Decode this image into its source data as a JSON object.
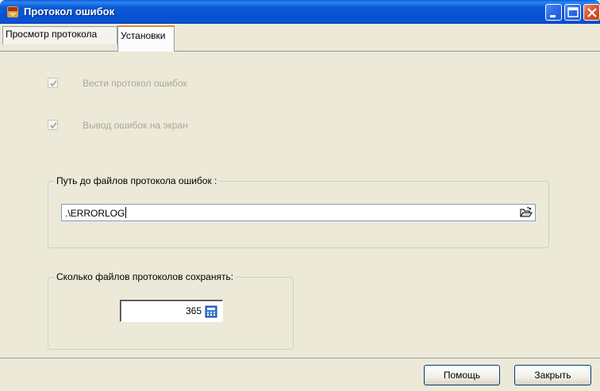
{
  "window": {
    "title": "Протокол ошибок"
  },
  "tabs": [
    {
      "label": "Просмотр протокола",
      "active": false
    },
    {
      "label": "Установки",
      "active": true
    }
  ],
  "settings": {
    "log_errors": {
      "label": "Вести протокол ошибок",
      "checked": true,
      "enabled": false
    },
    "show_errors": {
      "label": "Вывод ошибок на экран",
      "checked": true,
      "enabled": false
    },
    "path_group": {
      "legend": "Путь до файлов протокола ошибок :",
      "value": ".\\ERRORLOG",
      "button_icon": "folder-open-icon"
    },
    "count_group": {
      "legend": "Сколько файлов протоколов сохранять:",
      "value": "365",
      "button_icon": "calculator-icon"
    }
  },
  "buttons": {
    "help": "Помощь",
    "close": "Закрыть"
  },
  "colors": {
    "titlebar": "#0a55d6",
    "window_bg": "#ece9d8",
    "active_tab_accent": "#e68b2c",
    "disabled_text": "#aca899"
  }
}
